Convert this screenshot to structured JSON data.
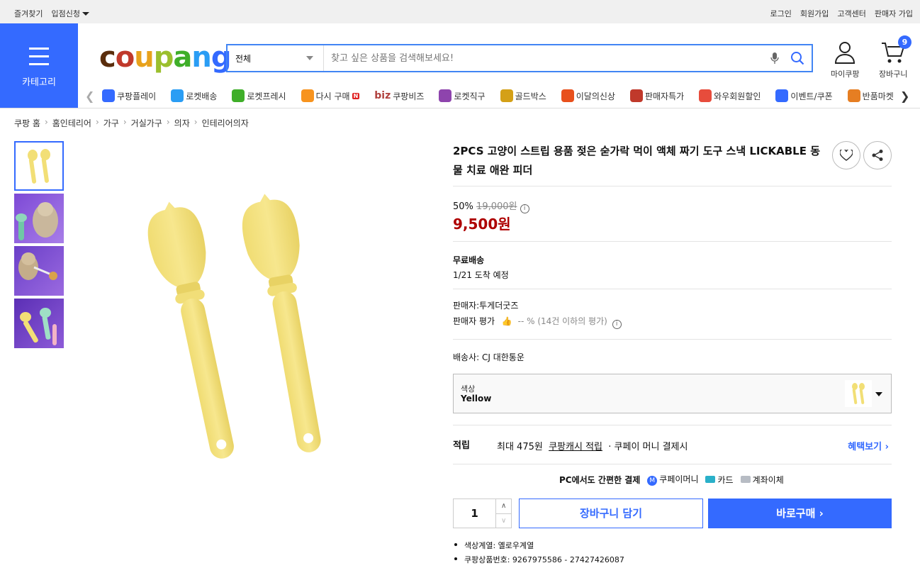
{
  "topbar": {
    "bookmark": "즐겨찾기",
    "partner": "입점신청",
    "login": "로그인",
    "signup": "회원가입",
    "support": "고객센터",
    "seller_signup": "판매자 가입"
  },
  "category_button": {
    "label": "카테고리"
  },
  "logo": {
    "text": "coupang"
  },
  "search": {
    "category": "전체",
    "placeholder": "찾고 싶은 상품을 검색해보세요!"
  },
  "header_icons": {
    "mycoupang": "마이쿠팡",
    "cart": "장바구니",
    "cart_count": "9"
  },
  "nav_items": [
    {
      "label": "쿠팡플레이",
      "icon": "play-icon",
      "color": "#346aff"
    },
    {
      "label": "로켓배송",
      "icon": "rocket-icon",
      "color": "#2a9df4"
    },
    {
      "label": "로켓프레시",
      "icon": "rocket-fresh-icon",
      "color": "#3fae29"
    },
    {
      "label": "다시 구매",
      "icon": "rebuy-icon",
      "color": "#f7931e",
      "badge": "N"
    },
    {
      "label": "쿠팡비즈",
      "icon": "biz-icon",
      "color": "#b0413e",
      "prefix": "biz"
    },
    {
      "label": "로켓직구",
      "icon": "global-rocket-icon",
      "color": "#8e44ad"
    },
    {
      "label": "골드박스",
      "icon": "goldbox-icon",
      "color": "#d4a017"
    },
    {
      "label": "이달의신상",
      "icon": "new-bag-icon",
      "color": "#e8501c"
    },
    {
      "label": "판매자특가",
      "icon": "percent-icon",
      "color": "#c0392b"
    },
    {
      "label": "와우회원할인",
      "icon": "wow-icon",
      "color": "#e74c3c"
    },
    {
      "label": "이벤트/쿠폰",
      "icon": "coupon-icon",
      "color": "#346aff"
    },
    {
      "label": "반품마켓",
      "icon": "return-market-icon",
      "color": "#e67e22"
    }
  ],
  "breadcrumb": [
    "쿠팡 홈",
    "홈인테리어",
    "가구",
    "거실가구",
    "의자",
    "인테리어의자"
  ],
  "product": {
    "title": "2PCS 고양이 스트립 용품 젖은 숟가락 먹이 액체 짜기 도구 스낵 LICKABLE 동물 치료 애완 피더",
    "discount_rate": "50%",
    "original_price": "19,000원",
    "price": "9,500원",
    "shipping_title": "무료배송",
    "arrival": "1/21 도착 예정",
    "seller": "판매자:투게더굿즈",
    "seller_rating_label": "판매자 평가",
    "seller_rating_value": "-- % (14건 이하의 평가)",
    "carrier": "배송사:  CJ 대한통운",
    "option_label": "색상",
    "option_value": "Yellow",
    "reward_title": "적립",
    "reward_text": "최대 475원",
    "reward_link": "쿠팡캐시 적립",
    "reward_note": "· 쿠페이 머니 결제시",
    "benefit_link": "혜택보기",
    "pay_title": "PC에서도 간편한 결제",
    "pay_methods": [
      "쿠페이머니",
      "카드",
      "계좌이체"
    ],
    "quantity": "1",
    "add_to_cart": "장바구니 담기",
    "buy_now": "바로구매",
    "attributes": [
      "색상계열: 옐로우계열",
      "쿠팡상품번호: 9267975586 - 27427426087"
    ]
  },
  "colors": {
    "brand_blue": "#346aff",
    "price_red": "#ae0000",
    "product_yellow": "#f4e27a"
  }
}
